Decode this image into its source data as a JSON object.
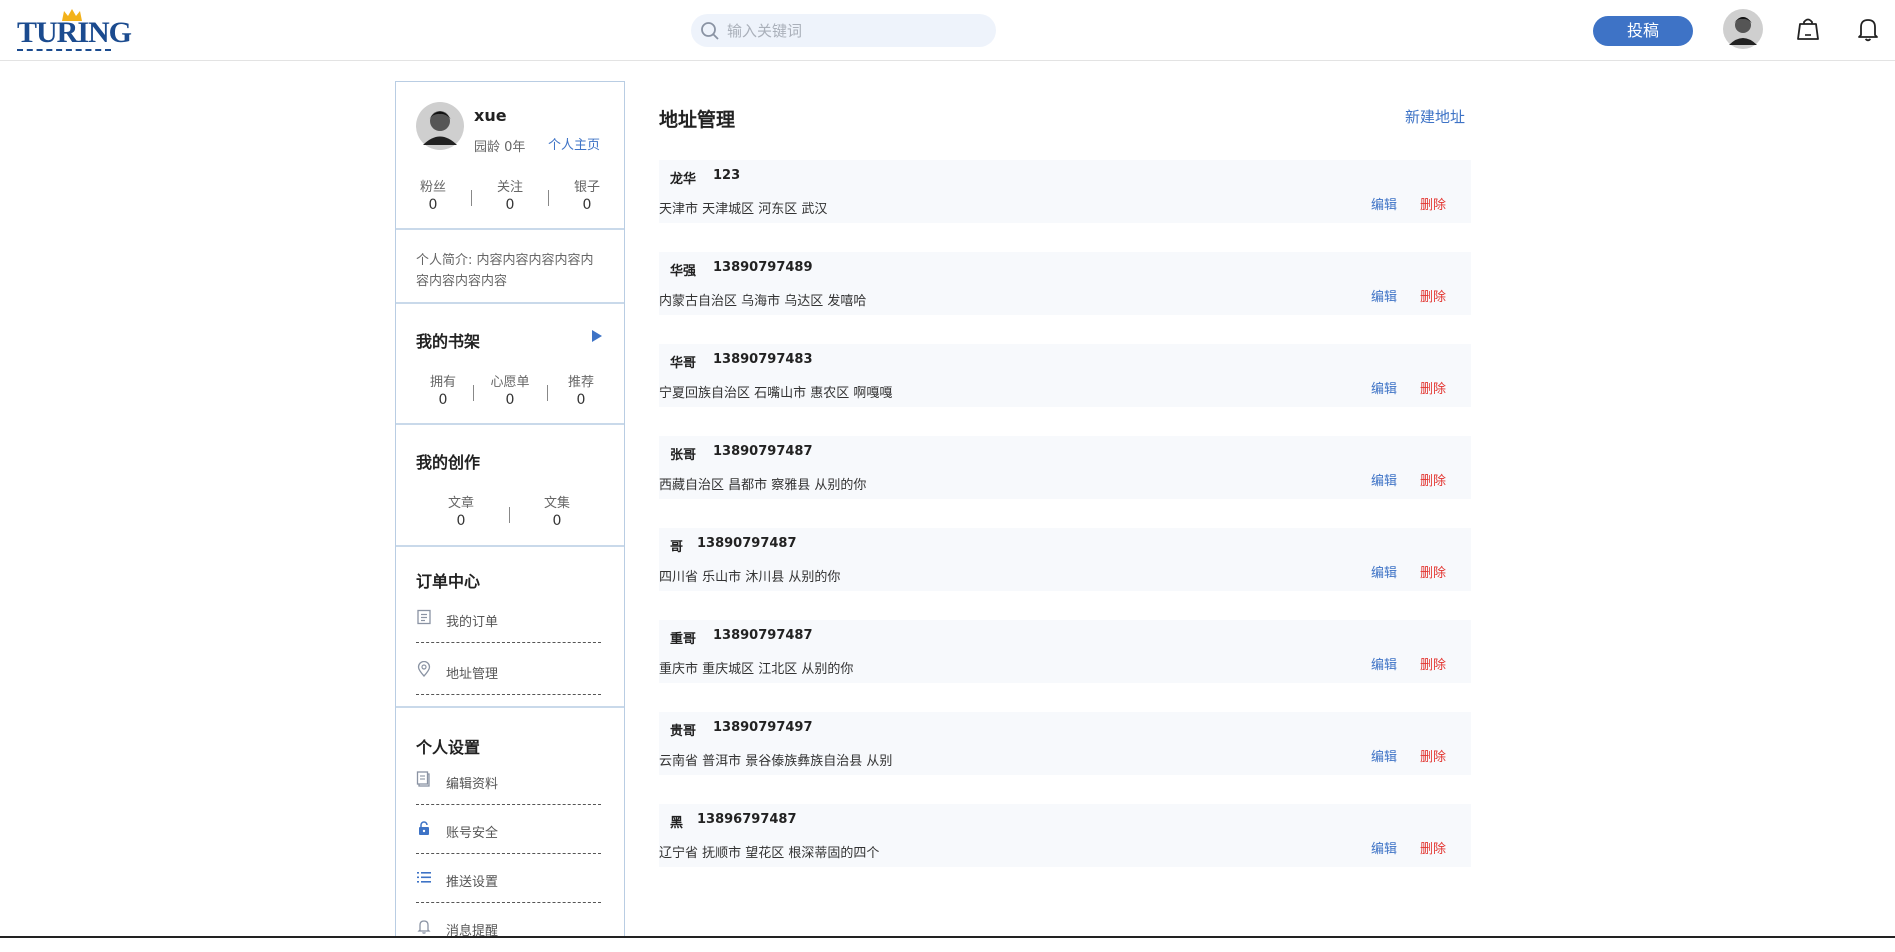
{
  "header": {
    "logo_text": "TURING",
    "search_placeholder": "输入关键词",
    "submit_label": "投稿"
  },
  "profile": {
    "username": "xue",
    "garden_age": "园龄 0年",
    "homepage_link": "个人主页",
    "stats": [
      {
        "label": "粉丝",
        "value": "0"
      },
      {
        "label": "关注",
        "value": "0"
      },
      {
        "label": "银子",
        "value": "0"
      }
    ],
    "intro": "个人简介: 内容内容内容内容内容内容内容内容"
  },
  "bookshelf": {
    "title": "我的书架",
    "stats": [
      {
        "label": "拥有",
        "value": "0"
      },
      {
        "label": "心愿单",
        "value": "0"
      },
      {
        "label": "推荐",
        "value": "0"
      }
    ]
  },
  "creation": {
    "title": "我的创作",
    "stats": [
      {
        "label": "文章",
        "value": "0"
      },
      {
        "label": "文集",
        "value": "0"
      }
    ]
  },
  "orders": {
    "title": "订单中心",
    "items": [
      {
        "label": "我的订单",
        "icon": "order-list-icon"
      },
      {
        "label": "地址管理",
        "icon": "location-pin-icon"
      }
    ]
  },
  "settings": {
    "title": "个人设置",
    "items": [
      {
        "label": "编辑资料",
        "icon": "edit-profile-icon"
      },
      {
        "label": "账号安全",
        "icon": "lock-icon"
      },
      {
        "label": "推送设置",
        "icon": "list-settings-icon"
      },
      {
        "label": "消息提醒",
        "icon": "bell-icon"
      }
    ]
  },
  "main": {
    "title": "地址管理",
    "new_address_label": "新建地址",
    "edit_label": "编辑",
    "delete_label": "删除",
    "addresses": [
      {
        "name": "龙华",
        "phone": "123",
        "address": "天津市 天津城区 河东区 武汉"
      },
      {
        "name": "华强",
        "phone": "13890797489",
        "address": "内蒙古自治区 乌海市 乌达区 发嘻哈"
      },
      {
        "name": "华哥",
        "phone": "13890797483",
        "address": "宁夏回族自治区 石嘴山市 惠农区 啊嘎嘎"
      },
      {
        "name": "张哥",
        "phone": "13890797487",
        "address": "西藏自治区 昌都市 察雅县 从别的你"
      },
      {
        "name": "哥",
        "phone": "13890797487",
        "address": "四川省 乐山市 沐川县 从别的你"
      },
      {
        "name": "重哥",
        "phone": "13890797487",
        "address": "重庆市 重庆城区 江北区 从别的你"
      },
      {
        "name": "贵哥",
        "phone": "13890797497",
        "address": "云南省 普洱市 景谷傣族彝族自治县 从别"
      },
      {
        "name": "黑",
        "phone": "13896797487",
        "address": "辽宁省 抚顺市 望花区 根深蒂固的四个"
      }
    ]
  },
  "colors": {
    "accent": "#3e73c6",
    "danger": "#e3342f",
    "logo": "#1b4b8f"
  }
}
